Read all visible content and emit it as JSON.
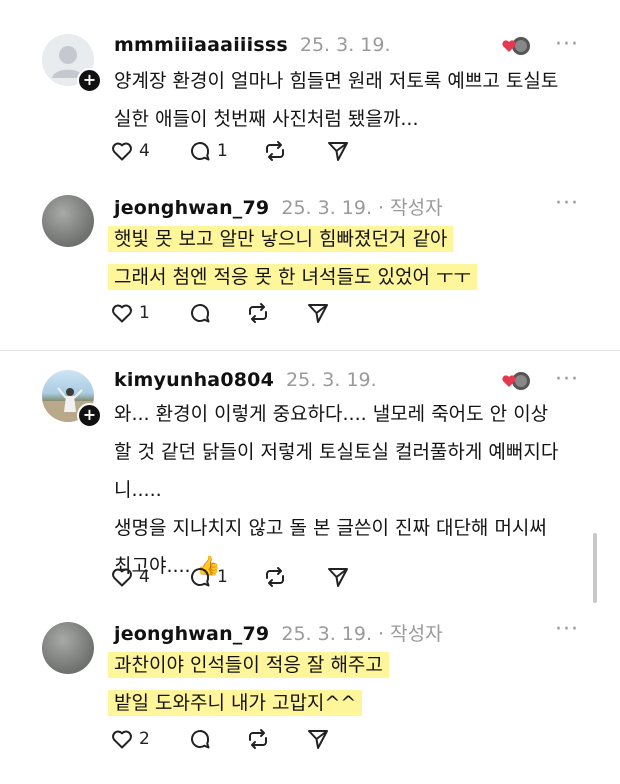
{
  "posts": [
    {
      "username": "mmmiiiaaaiiisss",
      "date": "25. 3. 19.",
      "author_tag": "",
      "lines": [
        "양계장 환경이 얼마나 힘들면 원래 저토록 예쁘고 토실토",
        "실한 애들이 첫번째 사진처럼 됐을까..."
      ],
      "likes": "4",
      "replies": "1",
      "more": "···"
    },
    {
      "username": "jeonghwan_79",
      "date": "25. 3. 19.",
      "author_tag": "· 작성자",
      "lines": [
        "햇빛 못 보고 알만 낳으니 힘빠졌던거 같아",
        "그래서 첨엔 적응 못 한 녀석들도 있었어 ㅜㅜ"
      ],
      "likes": "1",
      "replies": "",
      "more": "···"
    },
    {
      "username": "kimyunha0804",
      "date": "25. 3. 19.",
      "author_tag": "",
      "lines": [
        "와... 환경이 이렇게 중요하다.... 낼모레 죽어도 안 이상",
        "할 것 같던 닭들이 저렇게 토실토실 컬러풀하게 예뻐지다",
        "니.....",
        "생명을 지나치지 않고 돌 본 글쓴이 진짜 대단해 머시써",
        "최고야.... 👍"
      ],
      "likes": "4",
      "replies": "1",
      "more": "···"
    },
    {
      "username": "jeonghwan_79",
      "date": "25. 3. 19.",
      "author_tag": "· 작성자",
      "lines": [
        "과찬이야 인석들이 적응 잘 해주고",
        "밭일 도와주니 내가 고맙지^^"
      ],
      "likes": "2",
      "replies": "",
      "more": "···"
    }
  ],
  "icons": {
    "like": "heart-icon",
    "reply": "comment-icon",
    "repost": "repost-icon",
    "share": "send-icon",
    "reaction": "reaction-icon"
  },
  "colors": {
    "highlight": "#fff59a",
    "username": "#111111",
    "muted": "#9a9a9a",
    "divider": "#e3e3e3"
  }
}
